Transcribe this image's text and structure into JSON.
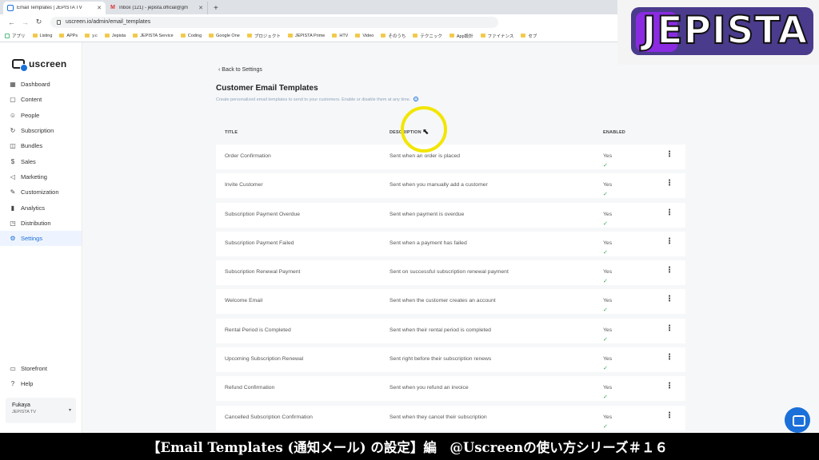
{
  "browser": {
    "tabs": [
      {
        "title": "Email Templates | JEPISTA TV",
        "active": true
      },
      {
        "title": "Inbox (121) - jepista.official@gm",
        "active": false
      }
    ],
    "new_tab": "+",
    "url": "uscreen.io/admin/email_templates",
    "bookmarks": [
      "アプリ",
      "Listing",
      "APPs",
      "y.c",
      "Jepista",
      "JEPISTA Service",
      "Coding",
      "Google One",
      "プロジェクト",
      "JEPISTA Prime",
      "HTV",
      "Video",
      "そのうち",
      "テクニック",
      "App設計",
      "ファイナンス",
      "セブ"
    ]
  },
  "overlay_logo": "JEPISTA",
  "app": {
    "brand": "uscreen",
    "menu": [
      {
        "label": "Dashboard",
        "icon": "grid-icon",
        "glyph": "▦",
        "active": false
      },
      {
        "label": "Content",
        "icon": "content-icon",
        "glyph": "▢",
        "active": false
      },
      {
        "label": "People",
        "icon": "people-icon",
        "glyph": "☺",
        "active": false
      },
      {
        "label": "Subscription",
        "icon": "subscription-icon",
        "glyph": "↻",
        "active": false
      },
      {
        "label": "Bundles",
        "icon": "bundle-icon",
        "glyph": "◫",
        "active": false
      },
      {
        "label": "Sales",
        "icon": "sales-icon",
        "glyph": "$",
        "active": false
      },
      {
        "label": "Marketing",
        "icon": "megaphone-icon",
        "glyph": "◁",
        "active": false
      },
      {
        "label": "Customization",
        "icon": "edit-icon",
        "glyph": "✎",
        "active": false
      },
      {
        "label": "Analytics",
        "icon": "analytics-icon",
        "glyph": "▮",
        "active": false
      },
      {
        "label": "Distribution",
        "icon": "distribution-icon",
        "glyph": "◳",
        "active": false
      },
      {
        "label": "Settings",
        "icon": "gear-icon",
        "glyph": "⚙",
        "active": true
      }
    ],
    "bottom_menu": [
      {
        "label": "Storefront",
        "icon": "storefront-icon",
        "glyph": "▭"
      },
      {
        "label": "Help",
        "icon": "help-icon",
        "glyph": "?"
      }
    ],
    "account": {
      "name": "Fukaya",
      "org": "JEPISTA TV"
    }
  },
  "page": {
    "back": "Back to Settings",
    "title": "Customer Email Templates",
    "description": "Create personalized email templates to send to your customers. Enable or disable them at any time.",
    "columns": {
      "title": "TITLE",
      "description": "DESCRIPTION",
      "enabled": "ENABLED"
    },
    "rows": [
      {
        "title": "Order Confirmation",
        "description": "Sent when an order is placed",
        "enabled": "Yes"
      },
      {
        "title": "Invite Customer",
        "description": "Sent when you manually add a customer",
        "enabled": "Yes"
      },
      {
        "title": "Subscription Payment Overdue",
        "description": "Sent when payment is overdue",
        "enabled": "Yes"
      },
      {
        "title": "Subscription Payment Failed",
        "description": "Sent when a payment has failed",
        "enabled": "Yes"
      },
      {
        "title": "Subscription Renewal Payment",
        "description": "Sent on successful subscription renewal payment",
        "enabled": "Yes"
      },
      {
        "title": "Welcome Email",
        "description": "Sent when the customer creates an account",
        "enabled": "Yes"
      },
      {
        "title": "Rental Period is Completed",
        "description": "Sent when their rental period is completed",
        "enabled": "Yes"
      },
      {
        "title": "Upcoming Subscription Renewal",
        "description": "Sent right before their subscription renews",
        "enabled": "Yes"
      },
      {
        "title": "Refund Confirmation",
        "description": "Sent when you refund an invoice",
        "enabled": "Yes"
      },
      {
        "title": "Cancelled Subscription Confirmation",
        "description": "Sent when they cancel their subscription",
        "enabled": "Yes"
      }
    ]
  },
  "caption": "【Email Templates (通知メール) の設定】編　@Uscreenの使い方シリーズ＃１６",
  "colors": {
    "accent": "#1b6fd8",
    "check": "#2ea44f",
    "highlight": "#f2e600",
    "logo_bg": "#4b3b8c"
  }
}
